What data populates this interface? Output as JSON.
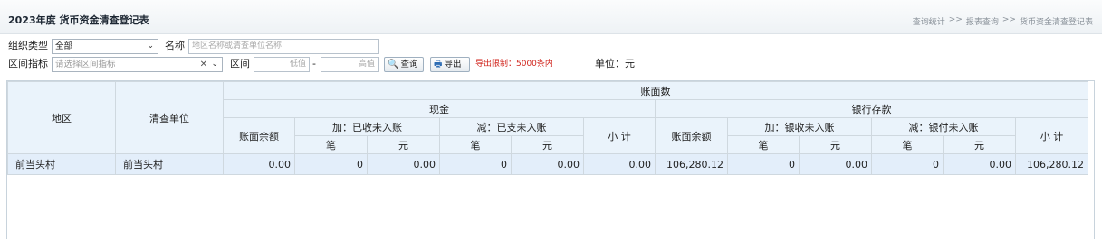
{
  "header": {
    "title": "2023年度 货币资金清查登记表",
    "breadcrumb": [
      "查询统计",
      "报表查询",
      "货币资金清查登记表"
    ],
    "breadcrumb_sep": ">>"
  },
  "filters": {
    "org_type_label": "组织类型",
    "org_type_value": "全部",
    "name_label": "名称",
    "name_placeholder": "地区名称或清查单位名称",
    "range_indicator_label": "区间指标",
    "range_indicator_placeholder": "请选择区间指标",
    "range_label": "区间",
    "low_placeholder": "低值",
    "range_dash": "-",
    "high_placeholder": "高值",
    "query_button": "查询",
    "export_button": "导出",
    "export_limit": "导出限制：5000条内",
    "unit_text": "单位：元"
  },
  "table": {
    "h_region": "地区",
    "h_unit": "清查单位",
    "h_book": "账面数",
    "h_cash": "现金",
    "h_bank": "银行存款",
    "h_book_balance": "账面余额",
    "h_add_received": "加：已收未入账",
    "h_sub_paid": "减：已支未入账",
    "h_subtotal": "小 计",
    "h_add_bank_received": "加：银收未入账",
    "h_sub_bank_paid": "减：银付未入账",
    "h_count": "笔",
    "h_yuan": "元",
    "rows": [
      {
        "region": "前当头村",
        "unit": "前当头村",
        "cash_balance": "0.00",
        "cash_add_count": "0",
        "cash_add_amount": "0.00",
        "cash_sub_count": "0",
        "cash_sub_amount": "0.00",
        "cash_subtotal": "0.00",
        "bank_balance": "106,280.12",
        "bank_add_count": "0",
        "bank_add_amount": "0.00",
        "bank_sub_count": "0",
        "bank_sub_amount": "0.00",
        "bank_subtotal": "106,280.12"
      }
    ]
  },
  "colors": {
    "header_bg": "#eaf3fb",
    "row_selected": "#e3eefa",
    "limit_text": "#d0231b"
  }
}
